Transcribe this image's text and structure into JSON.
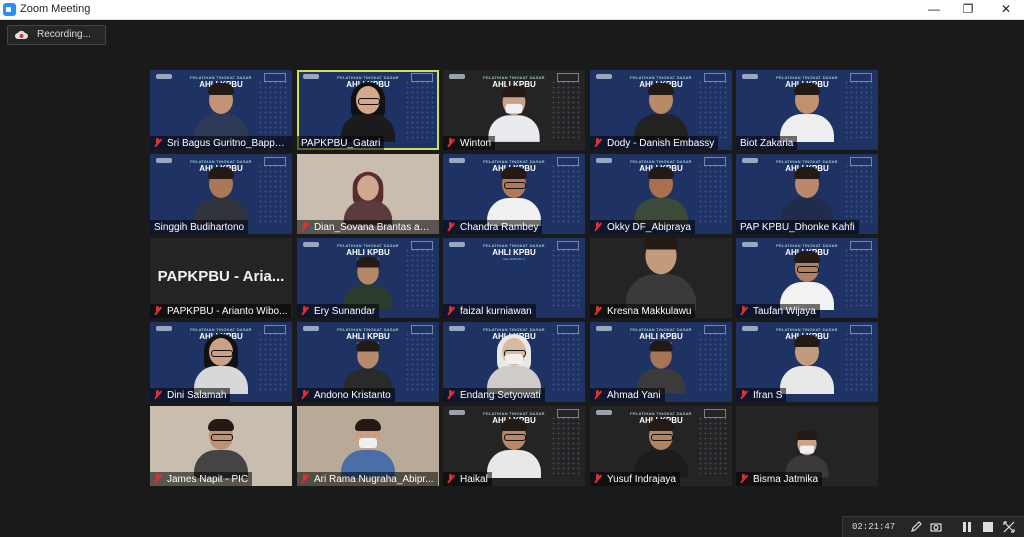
{
  "window": {
    "title": "Zoom Meeting",
    "controls": {
      "minimize": "—",
      "maximize": "❐",
      "close": "✕"
    }
  },
  "recording": {
    "label": "Recording..."
  },
  "banner": {
    "line1": "PELATIHAN TINGKAT DASAR",
    "line2": "AHLI KPBU",
    "line3": "GELOMBANG 4"
  },
  "participants": [
    {
      "name": "Sri Bagus Guritno_Bappe...",
      "muted": true
    },
    {
      "name": "PAPKPBU_Gatari",
      "muted": false,
      "active": true
    },
    {
      "name": "Winton",
      "muted": true
    },
    {
      "name": "Dody - Danish Embassy",
      "muted": true
    },
    {
      "name": "Biot Zakaria",
      "muted": false
    },
    {
      "name": "Singgih Budihartono",
      "muted": false
    },
    {
      "name": "Dian_Sovana Brantas abi...",
      "muted": true
    },
    {
      "name": "Chandra Rambey",
      "muted": true
    },
    {
      "name": "Okky DF_Abipraya",
      "muted": true
    },
    {
      "name": "PAP KPBU_Dhonke Kahfi",
      "muted": false
    },
    {
      "name": "PAPKPBU - Arianto Wibo...",
      "muted": true,
      "no_video_label": "PAPKPBU - Aria..."
    },
    {
      "name": "Ery Sunandar",
      "muted": true
    },
    {
      "name": "faizal kurniawan",
      "muted": true
    },
    {
      "name": "Kresna Makkulawu",
      "muted": true
    },
    {
      "name": "Taufan Wijaya",
      "muted": true
    },
    {
      "name": "Dini Salamah",
      "muted": true
    },
    {
      "name": "Andono Kristanto",
      "muted": true
    },
    {
      "name": "Endang Setyowati",
      "muted": true
    },
    {
      "name": "Ahmad Yani",
      "muted": true
    },
    {
      "name": "Ifran S",
      "muted": true
    },
    {
      "name": "James Napit - PIC",
      "muted": true
    },
    {
      "name": "Ari Rama Nugraha_Abipr...",
      "muted": true
    },
    {
      "name": "Haikal",
      "muted": true
    },
    {
      "name": "Yusuf Indrajaya",
      "muted": true
    },
    {
      "name": "Bisma Jatmika",
      "muted": true
    }
  ],
  "bottombar": {
    "timer": "02:21:47",
    "icons": [
      "pencil-icon",
      "camera-icon",
      "pause-icon",
      "stop-icon",
      "arrows-icon"
    ]
  }
}
